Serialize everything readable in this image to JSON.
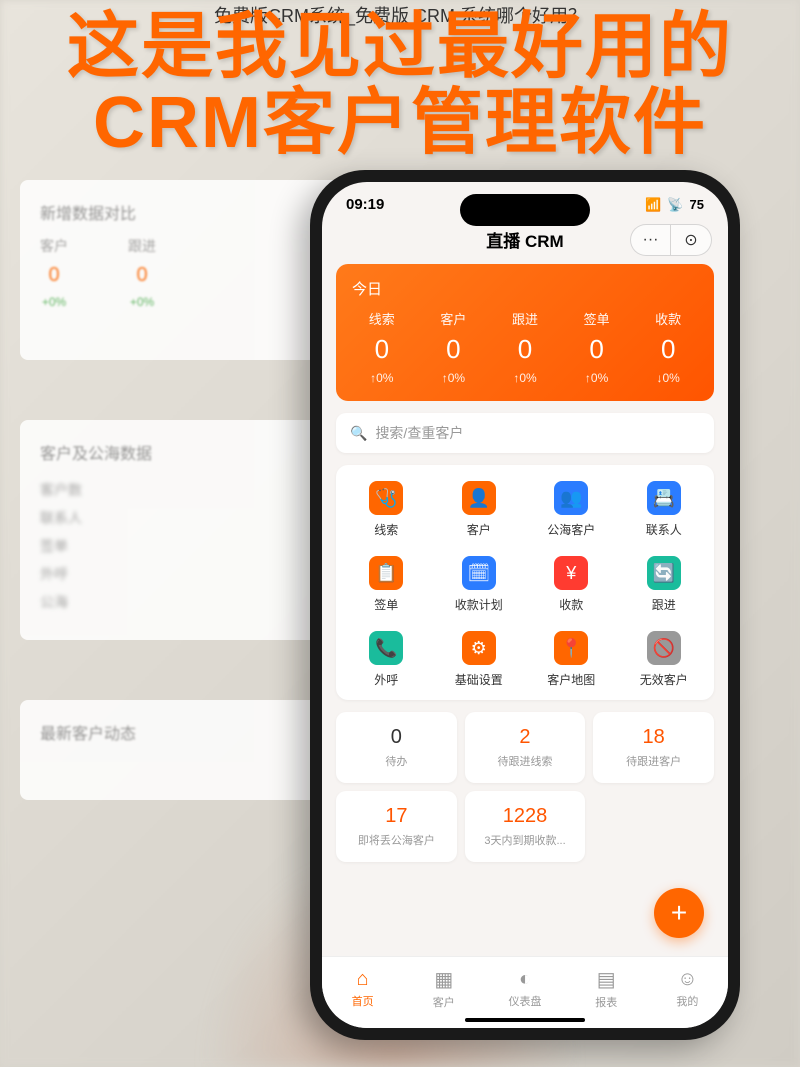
{
  "caption": "免费版CRM系统_免费版 CRM 系统哪个好用？",
  "headline_line1": "这是我见过最好用的",
  "headline_line2": "CRM客户管理软件",
  "desktop": {
    "sectionA": "新增数据对比",
    "colA": "客户",
    "colB": "跟进",
    "pct": "+0%",
    "sectionB": "客户及公海数据",
    "sectionC": "最新客户动态"
  },
  "status": {
    "time": "09:19",
    "battery": "75"
  },
  "mp": {
    "title": "直播 CRM",
    "more": "···",
    "close": "⊙"
  },
  "stats": {
    "today": "今日",
    "items": [
      {
        "label": "线索",
        "value": "0",
        "change": "↑0%"
      },
      {
        "label": "客户",
        "value": "0",
        "change": "↑0%"
      },
      {
        "label": "跟进",
        "value": "0",
        "change": "↑0%"
      },
      {
        "label": "签单",
        "value": "0",
        "change": "↑0%"
      },
      {
        "label": "收款",
        "value": "0",
        "change": "↓0%"
      }
    ]
  },
  "search": {
    "placeholder": "搜索/查重客户",
    "icon": "🔍"
  },
  "grid": [
    {
      "label": "线索",
      "icon": "🩺",
      "bg": "#ff6600"
    },
    {
      "label": "客户",
      "icon": "👤",
      "bg": "#ff6600"
    },
    {
      "label": "公海客户",
      "icon": "👥",
      "bg": "#2b7cff"
    },
    {
      "label": "联系人",
      "icon": "📇",
      "bg": "#2b7cff"
    },
    {
      "label": "签单",
      "icon": "📋",
      "bg": "#ff6600"
    },
    {
      "label": "收款计划",
      "icon": "🗓",
      "bg": "#2b7cff"
    },
    {
      "label": "收款",
      "icon": "¥",
      "bg": "#ff3b30"
    },
    {
      "label": "跟进",
      "icon": "🔄",
      "bg": "#1abc9c"
    },
    {
      "label": "外呼",
      "icon": "📞",
      "bg": "#1abc9c"
    },
    {
      "label": "基础设置",
      "icon": "⚙",
      "bg": "#ff6600"
    },
    {
      "label": "客户地图",
      "icon": "📍",
      "bg": "#ff6600"
    },
    {
      "label": "无效客户",
      "icon": "🚫",
      "bg": "#999"
    }
  ],
  "counts": [
    {
      "value": "0",
      "label": "待办",
      "red": false
    },
    {
      "value": "2",
      "label": "待跟进线索",
      "red": true
    },
    {
      "value": "18",
      "label": "待跟进客户",
      "red": true
    },
    {
      "value": "17",
      "label": "即将丢公海客户",
      "red": true
    },
    {
      "value": "1228",
      "label": "3天内到期收款...",
      "red": true
    }
  ],
  "fab": "+",
  "nav": [
    {
      "label": "首页",
      "icon": "⌂",
      "active": true
    },
    {
      "label": "客户",
      "icon": "▦",
      "active": false
    },
    {
      "label": "仪表盘",
      "icon": "◐",
      "active": false
    },
    {
      "label": "报表",
      "icon": "▤",
      "active": false
    },
    {
      "label": "我的",
      "icon": "☺",
      "active": false
    }
  ]
}
